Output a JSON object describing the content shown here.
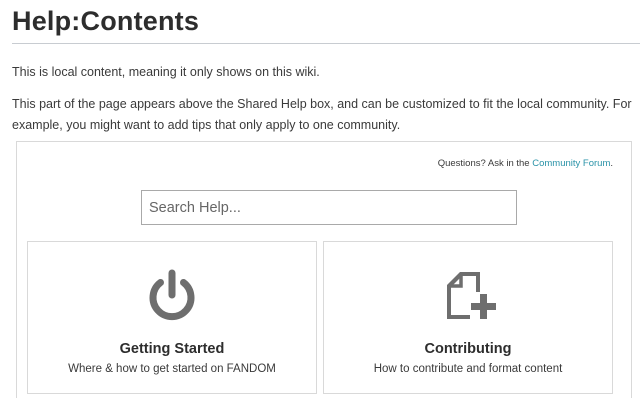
{
  "page": {
    "title": "Help:Contents",
    "intro_paragraph": "This is local content, meaning it only shows on this wiki.",
    "second_paragraph": "This part of the page appears above the Shared Help box, and can be customized to fit the local community. For example, you might want to add tips that only apply to one community."
  },
  "help_box": {
    "ask_prefix": "Questions? Ask in the ",
    "ask_link": "Community Forum",
    "ask_suffix": ".",
    "search": {
      "placeholder": "Search Help...",
      "value": ""
    },
    "cards": [
      {
        "title": "Getting Started",
        "description": "Where & how to get started on FANDOM",
        "icon": "power-icon"
      },
      {
        "title": "Contributing",
        "description": "How to contribute and format content",
        "icon": "add-page-icon"
      }
    ]
  },
  "colors": {
    "link": "#2a93a8",
    "icon_gray": "#6e6e6e",
    "border": "#d9d9d9",
    "text": "#3a3a3a"
  }
}
